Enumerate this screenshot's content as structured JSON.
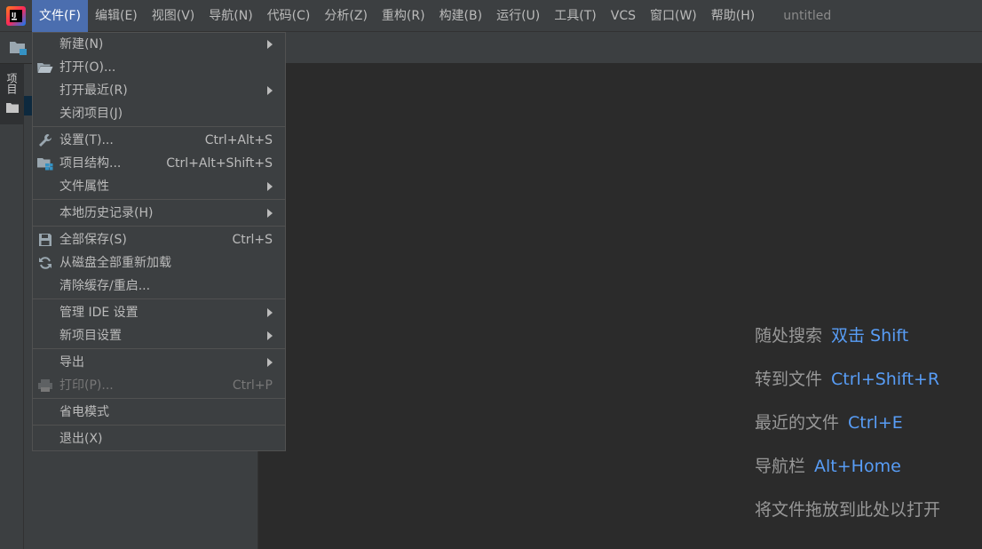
{
  "menubar": {
    "items": [
      "文件(F)",
      "编辑(E)",
      "视图(V)",
      "导航(N)",
      "代码(C)",
      "分析(Z)",
      "重构(R)",
      "构建(B)",
      "运行(U)",
      "工具(T)",
      "VCS",
      "窗口(W)",
      "帮助(H)"
    ],
    "project_title": "untitled",
    "active_color": "#4b6eaf"
  },
  "left_stripe": {
    "project_tab_label": "项目"
  },
  "file_menu": {
    "new": {
      "label": "新建(N)"
    },
    "open": {
      "label": "打开(O)...",
      "icon": "folder-open-icon"
    },
    "recent": {
      "label": "打开最近(R)"
    },
    "close_project": {
      "label": "关闭项目(J)"
    },
    "settings": {
      "label": "设置(T)...",
      "shortcut": "Ctrl+Alt+S",
      "icon": "wrench-icon"
    },
    "project_structure": {
      "label": "项目结构...",
      "shortcut": "Ctrl+Alt+Shift+S",
      "icon": "project-structure-icon"
    },
    "file_properties": {
      "label": "文件属性"
    },
    "local_history": {
      "label": "本地历史记录(H)"
    },
    "save_all": {
      "label": "全部保存(S)",
      "shortcut": "Ctrl+S",
      "icon": "save-icon"
    },
    "reload": {
      "label": "从磁盘全部重新加载",
      "icon": "refresh-icon"
    },
    "invalidate_caches": {
      "label": "清除缓存/重启..."
    },
    "manage_ide_settings": {
      "label": "管理 IDE 设置"
    },
    "new_project_settings": {
      "label": "新项目设置"
    },
    "export": {
      "label": "导出"
    },
    "print": {
      "label": "打印(P)...",
      "shortcut": "Ctrl+P",
      "icon": "print-icon"
    },
    "power_save": {
      "label": "省电模式"
    },
    "exit": {
      "label": "退出(X)"
    }
  },
  "editor_hints": [
    {
      "text": "随处搜索",
      "key": "双击 Shift"
    },
    {
      "text": "转到文件",
      "key": "Ctrl+Shift+R"
    },
    {
      "text": "最近的文件",
      "key": "Ctrl+E"
    },
    {
      "text": "导航栏",
      "key": "Alt+Home"
    },
    {
      "text": "将文件拖放到此处以打开",
      "key": ""
    }
  ]
}
